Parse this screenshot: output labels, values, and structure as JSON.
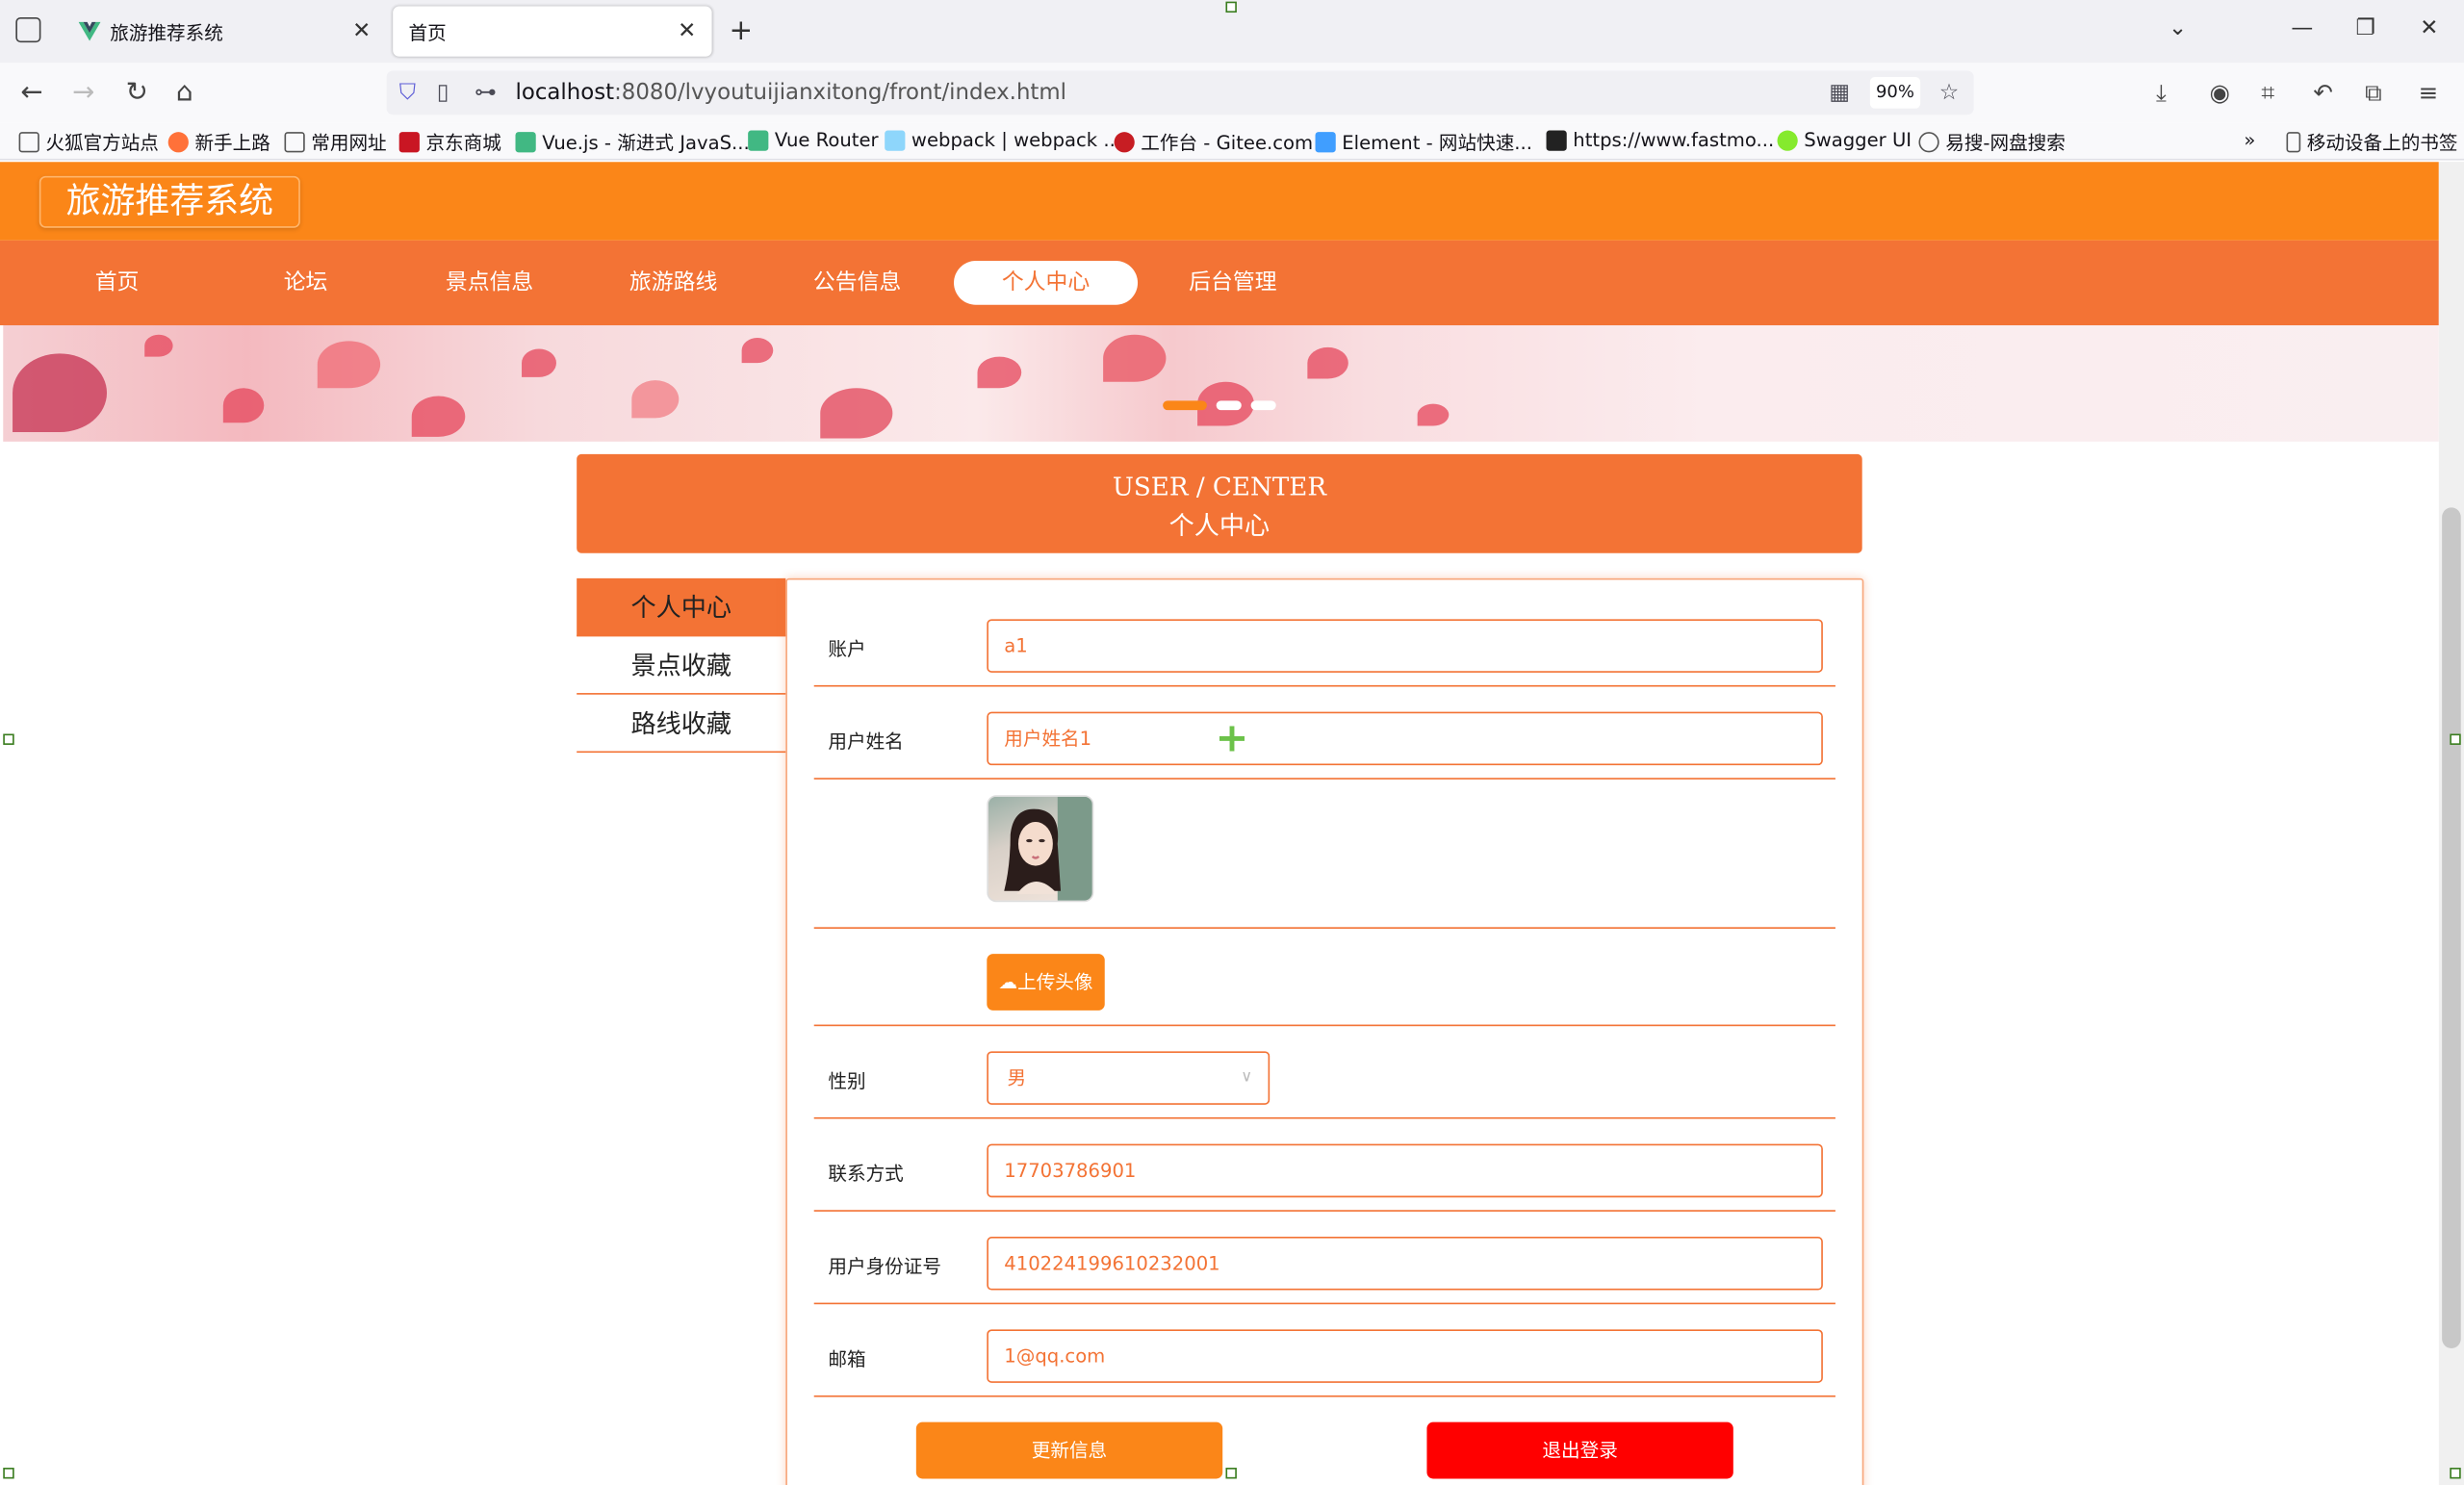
{
  "browser": {
    "tabs": [
      {
        "label": "旅游推荐系统"
      },
      {
        "label": "首页"
      }
    ],
    "url_host": "localhost",
    "url_path": ":8080/lvyoutuijianxitong/front/index.html",
    "zoom": "90%",
    "bookmarks": [
      "火狐官方站点",
      "新手上路",
      "常用网址",
      "京东商城",
      "Vue.js - 渐进式 JavaS...",
      "Vue Router",
      "webpack | webpack ...",
      "工作台 - Gitee.com",
      "Element - 网站快速...",
      "https://www.fastmo...",
      "Swagger UI",
      "易搜-网盘搜索"
    ],
    "mobile_bookmarks": "移动设备上的书签"
  },
  "site": {
    "logo": "旅游推荐系统",
    "nav": [
      {
        "label": "首页"
      },
      {
        "label": "论坛"
      },
      {
        "label": "景点信息"
      },
      {
        "label": "旅游路线"
      },
      {
        "label": "公告信息"
      },
      {
        "label": "个人中心"
      },
      {
        "label": "后台管理"
      }
    ],
    "active_nav": "个人中心"
  },
  "user_center": {
    "title_en": "USER / CENTER",
    "title_cn": "个人中心",
    "side_menu": [
      {
        "label": "个人中心"
      },
      {
        "label": "景点收藏"
      },
      {
        "label": "路线收藏"
      }
    ],
    "form": {
      "account_label": "账户",
      "account_value": "a1",
      "username_label": "用户姓名",
      "username_value": "用户姓名1",
      "upload_label": "上传头像",
      "gender_label": "性别",
      "gender_value": "男",
      "phone_label": "联系方式",
      "phone_value": "17703786901",
      "idcard_label": "用户身份证号",
      "idcard_value": "410224199610232001",
      "email_label": "邮箱",
      "email_value": "1@qq.com"
    },
    "update_button": "更新信息",
    "logout_button": "退出登录"
  },
  "colors": {
    "header": "#fb8618",
    "nav": "#f37335",
    "logout": "#ff0000"
  }
}
